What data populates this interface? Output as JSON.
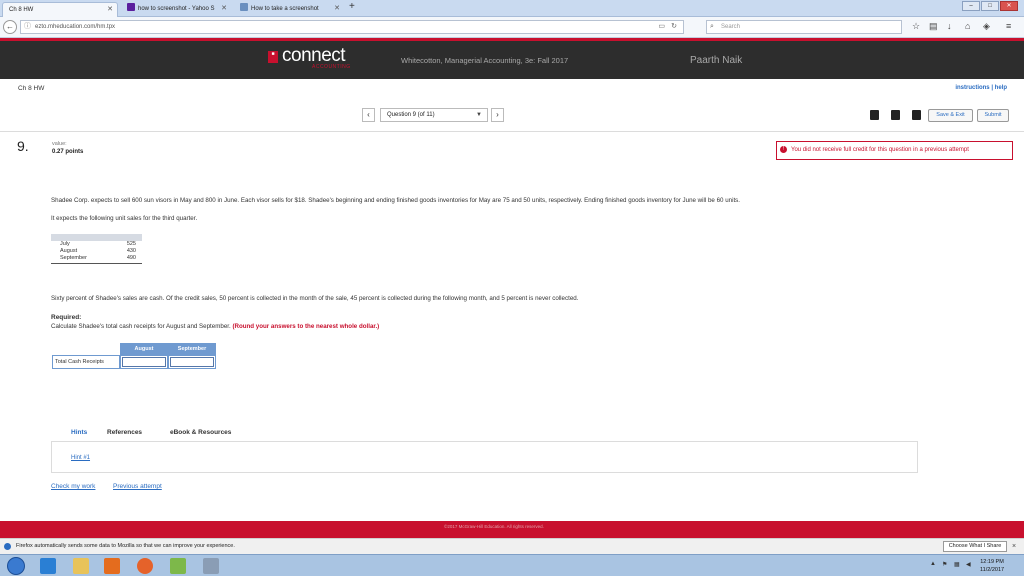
{
  "browser": {
    "tabs": [
      {
        "title": "Ch 8 HW"
      },
      {
        "title": "how to screenshot - Yahoo S"
      },
      {
        "title": "How to take a screenshot"
      }
    ],
    "url": "ezto.mheducation.com/hm.tpx",
    "search_placeholder": "Search"
  },
  "header": {
    "logo": "connect",
    "logo_sub": "ACCOUNTING",
    "course": "Whitecotton, Managerial Accounting, 3e: Fall 2017",
    "student": "Paarth Naik"
  },
  "page": {
    "assignment": "Ch 8 HW",
    "instructions_link": "instructions | help",
    "question_select": "Question 9 (of 11)",
    "save_exit": "Save & Exit",
    "submit": "Submit"
  },
  "question": {
    "number": "9.",
    "value_label": "value:",
    "points": "0.27 points",
    "alert": "You did not receive full credit for this question in a previous attempt",
    "text1": "Shadee Corp. expects to sell 600 sun visors in May and 800 in June. Each visor sells for $18. Shadee's beginning and ending finished goods inventories for May are 75 and 50 units, respectively. Ending finished goods inventory for June will be 60 units.",
    "text2": "It expects the following unit sales for the third quarter.",
    "sales": [
      {
        "month": "July",
        "units": "525"
      },
      {
        "month": "August",
        "units": "430"
      },
      {
        "month": "September",
        "units": "490"
      }
    ],
    "text3": "Sixty percent of Shadee's sales are cash. Of the credit sales, 50 percent is collected in the month of the sale, 45 percent is collected during the following month, and 5 percent is never collected.",
    "required_label": "Required:",
    "required_text": "Calculate Shadee's total cash receipts for August and September.",
    "required_note": "(Round your answers to the nearest whole dollar.)",
    "answer_table": {
      "columns": [
        "August",
        "September"
      ],
      "row_label": "Total Cash Receipts"
    }
  },
  "resources": {
    "tabs": [
      "Hints",
      "References",
      "eBook & Resources"
    ],
    "hint": "Hint #1",
    "check_work": "Check my work",
    "previous_attempt": "Previous attempt"
  },
  "footer": {
    "copyright": "©2017 McGraw-Hill Education. All rights reserved."
  },
  "notification": {
    "text": "Firefox automatically sends some data to Mozilla so that we can improve your experience.",
    "share_button": "Choose What I Share"
  },
  "taskbar": {
    "time": "12:19 PM",
    "date": "11/2/2017"
  }
}
